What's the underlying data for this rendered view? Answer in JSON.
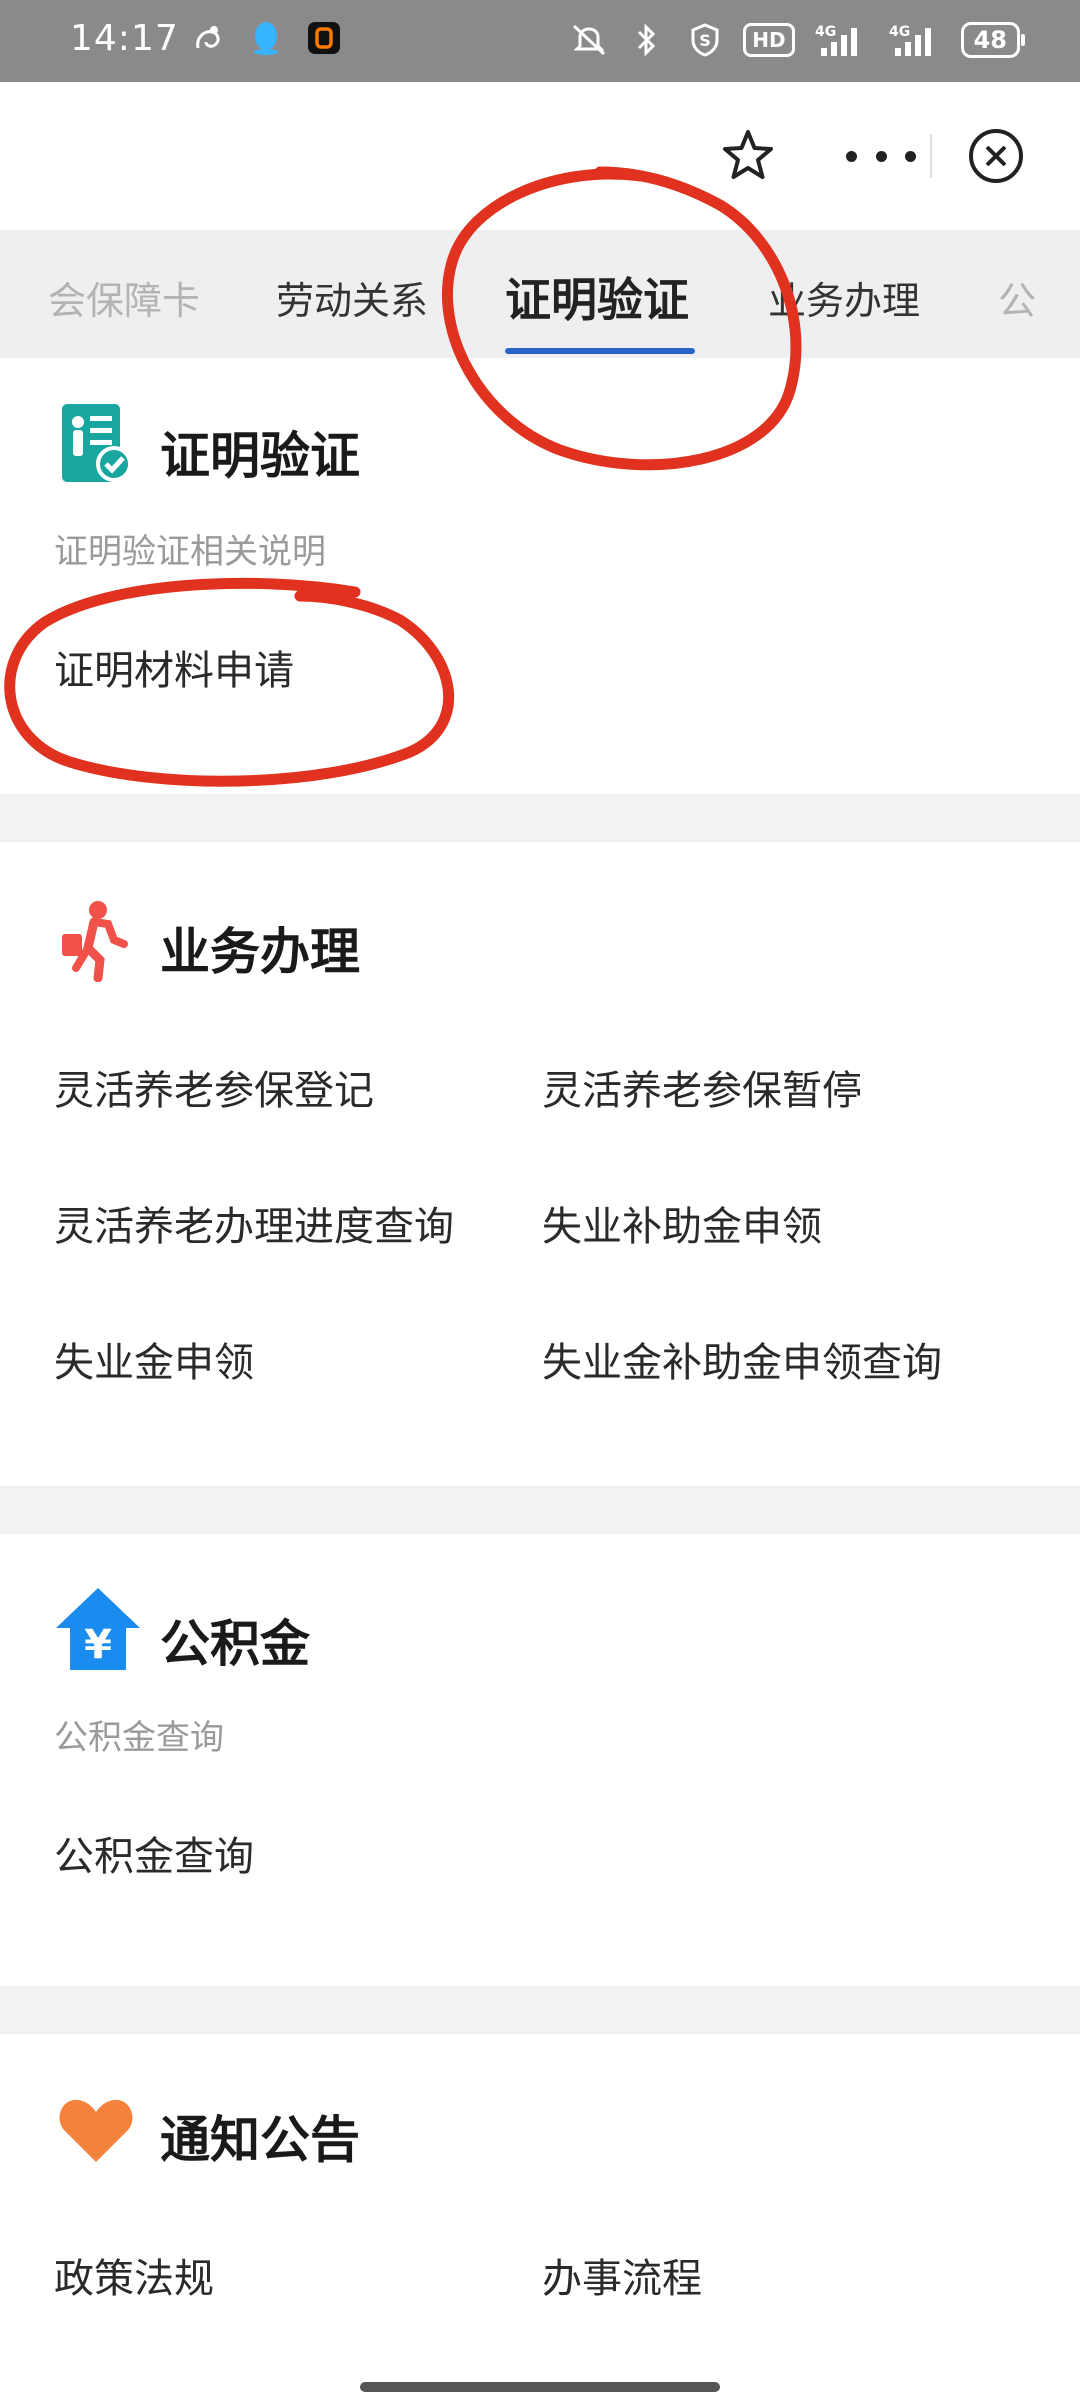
{
  "status_bar": {
    "time": "14:17",
    "hd_label": "HD",
    "signal1_label": "4G",
    "signal2_label": "4G",
    "battery": "48"
  },
  "tabs": [
    {
      "label": "会保障卡"
    },
    {
      "label": "劳动关系"
    },
    {
      "label": "证明验证",
      "active": true
    },
    {
      "label": "业务办理"
    },
    {
      "label": "公"
    }
  ],
  "sections": {
    "certificate": {
      "title": "证明验证",
      "subtitle": "证明验证相关说明",
      "items": [
        "证明材料申请"
      ]
    },
    "business": {
      "title": "业务办理",
      "items": [
        "灵活养老参保登记",
        "灵活养老参保暂停",
        "灵活养老办理进度查询",
        "失业补助金申领",
        "失业金申领",
        "失业金补助金申领查询"
      ]
    },
    "fund": {
      "title": "公积金",
      "subtitle": "公积金查询",
      "items": [
        "公积金查询"
      ]
    },
    "notice": {
      "title": "通知公告",
      "items": [
        "政策法规",
        "办事流程"
      ]
    }
  },
  "colors": {
    "accent_blue": "#2a64c8",
    "annotation_red": "#e0321e",
    "teal_icon": "#1aa6a0",
    "fund_blue": "#1a8cf0",
    "orange_heart": "#f5823c"
  }
}
